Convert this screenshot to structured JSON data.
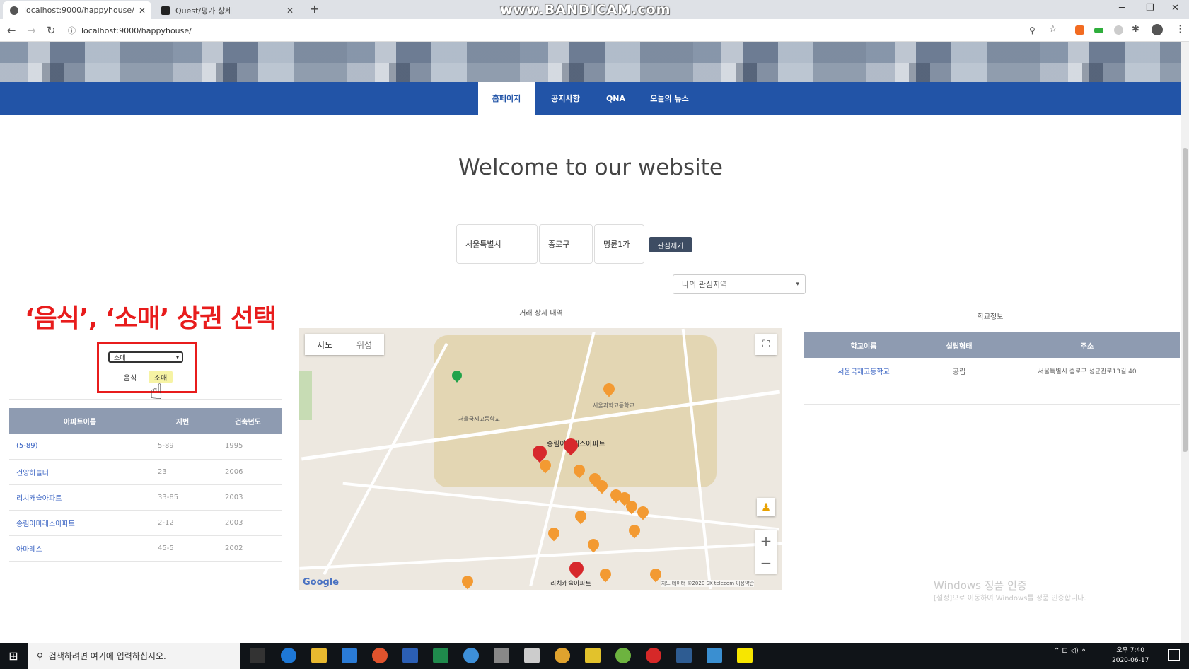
{
  "browser": {
    "tabs": [
      {
        "title": "localhost:9000/happyhouse/",
        "active": true
      },
      {
        "title": "Quest/평가 상세",
        "active": false
      }
    ],
    "new_tab": "+",
    "recorder_watermark": "www.BANDICAM.com",
    "url": "localhost:9000/happyhouse/"
  },
  "nav": {
    "items": [
      "홈페이지",
      "공지사항",
      "QNA",
      "오늘의 뉴스"
    ],
    "active_index": 0,
    "color": "#2254a7"
  },
  "main": {
    "heading": "Welcome to our website",
    "region": {
      "city": "서울특별시",
      "district": "종로구",
      "dong": "명륜1가",
      "remove_button": "관심제거"
    },
    "my_area_select": "나의 관심지역"
  },
  "left": {
    "annotation": "‘음식’, ‘소매’ 상권 선택",
    "category_select": "소매",
    "options": [
      "음식",
      "소매"
    ],
    "highlighted_option": "소매",
    "table": {
      "headers": [
        "아파트이름",
        "지번",
        "건축년도"
      ],
      "rows": [
        [
          "(5-89)",
          "5-89",
          "1995"
        ],
        [
          "건양하늘터",
          "23",
          "2006"
        ],
        [
          "리치캐슬아파트",
          "33-85",
          "2003"
        ],
        [
          "송림아마레스아파트",
          "2-12",
          "2003"
        ],
        [
          "아마레스",
          "45-5",
          "2002"
        ]
      ]
    }
  },
  "map": {
    "title": "거래 상세 내역",
    "type_buttons": [
      "지도",
      "위성"
    ],
    "zoom_in": "+",
    "zoom_out": "−",
    "logo": "Google",
    "attribution": "지도 데이터 ©2020 SK telecom  이용약관",
    "labels": [
      "서울과학고등학교",
      "송림아마레스아파트",
      "리치캐슬아파트",
      "서울국제고등학교"
    ]
  },
  "school": {
    "title": "학교정보",
    "headers": [
      "학교이름",
      "설립형태",
      "주소"
    ],
    "rows": [
      [
        "서울국제고등학교",
        "공립",
        "서울특별시 종로구 성균관로13길 40"
      ]
    ]
  },
  "watermark": {
    "line1": "Windows 정품 인증",
    "line2": "[설정]으로 이동하여 Windows를 정품 인증합니다."
  },
  "taskbar": {
    "search_placeholder": "검색하려면 여기에 입력하십시오.",
    "time": "오후 7:40",
    "date": "2020-06-17"
  }
}
